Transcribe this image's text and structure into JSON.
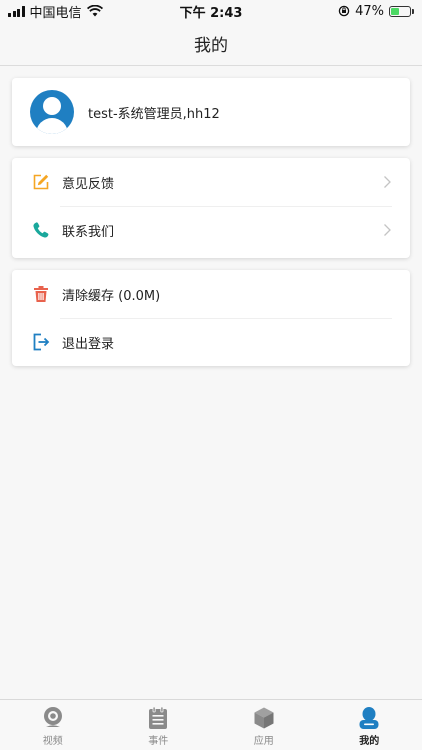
{
  "status_bar": {
    "carrier": "中国电信",
    "time": "下午 2:43",
    "battery_percent": "47%",
    "battery_level": 0.47,
    "icons": [
      "signal-icon",
      "wifi-icon",
      "orientation-lock-icon",
      "battery-icon"
    ]
  },
  "nav": {
    "title": "我的"
  },
  "profile": {
    "name": "test-系统管理员,hh12",
    "avatar_icon": "user-avatar-icon"
  },
  "menu_group_1": [
    {
      "label": "意见反馈",
      "icon": "edit-icon",
      "icon_color": "#f5a623"
    },
    {
      "label": "联系我们",
      "icon": "phone-icon",
      "icon_color": "#1aa89c"
    }
  ],
  "menu_group_2": [
    {
      "label": "清除缓存 (0.0M)",
      "icon": "trash-icon",
      "icon_color": "#e8624d"
    },
    {
      "label": "退出登录",
      "icon": "logout-icon",
      "icon_color": "#1f7fc2"
    }
  ],
  "tabs": [
    {
      "label": "视频",
      "icon": "camera-icon",
      "active": false
    },
    {
      "label": "事件",
      "icon": "clipboard-icon",
      "active": false
    },
    {
      "label": "应用",
      "icon": "cube-icon",
      "active": false
    },
    {
      "label": "我的",
      "icon": "user-icon",
      "active": true
    }
  ],
  "colors": {
    "accent": "#1f7fc2",
    "inactive_tab": "#8a8a8a",
    "background": "#f7f7f7"
  }
}
